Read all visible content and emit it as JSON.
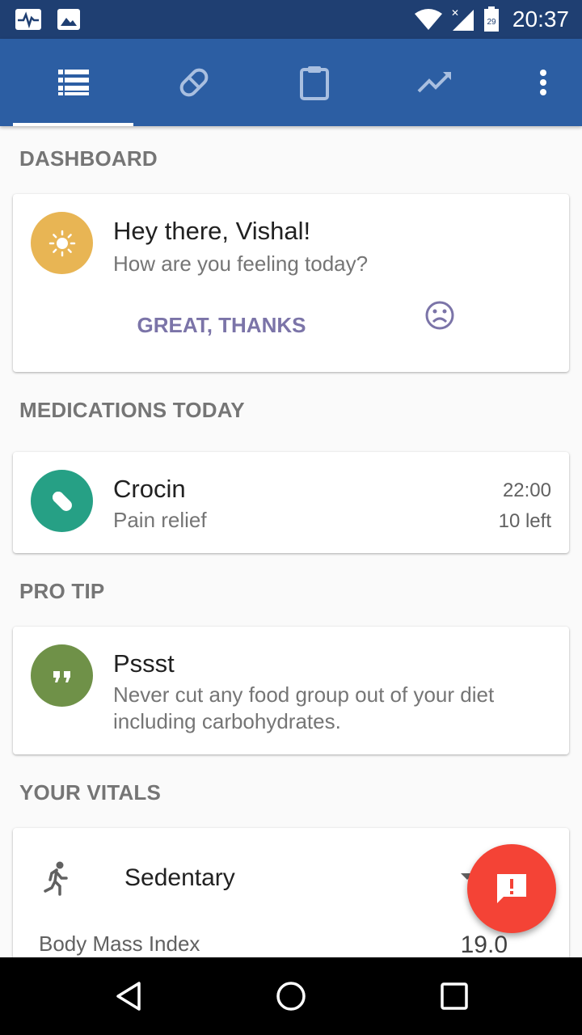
{
  "status_bar": {
    "time": "20:37",
    "icons": [
      "pulse-icon",
      "image-icon",
      "wifi-icon",
      "signal-icon",
      "battery-icon"
    ],
    "battery_level": "29"
  },
  "tabs": [
    {
      "icon": "list-icon",
      "active": true
    },
    {
      "icon": "pill-icon",
      "active": false
    },
    {
      "icon": "clipboard-icon",
      "active": false
    },
    {
      "icon": "trending-icon",
      "active": false
    }
  ],
  "dashboard": {
    "section_title": "DASHBOARD",
    "greeting": "Hey there, Vishal!",
    "question": "How are you feeling today?",
    "great_button": "GREAT, THANKS"
  },
  "medications": {
    "section_title": "MEDICATIONS TODAY",
    "name": "Crocin",
    "purpose": "Pain relief",
    "time": "22:00",
    "remaining": "10 left"
  },
  "pro_tip": {
    "section_title": "PRO TIP",
    "title": "Pssst",
    "text": "Never cut any food group out of your diet including carbohydrates."
  },
  "vitals": {
    "section_title": "YOUR VITALS",
    "activity": "Sedentary",
    "bmi_label": "Body Mass Index",
    "bmi_value": "19.0"
  },
  "colors": {
    "status_bar": "#1f3f72",
    "app_bar": "#2c5ea3",
    "sun_circle": "#e8b554",
    "pill_circle": "#26a085",
    "quote_circle": "#6f9148",
    "fab": "#f44336",
    "accent_text": "#7b74a8"
  }
}
